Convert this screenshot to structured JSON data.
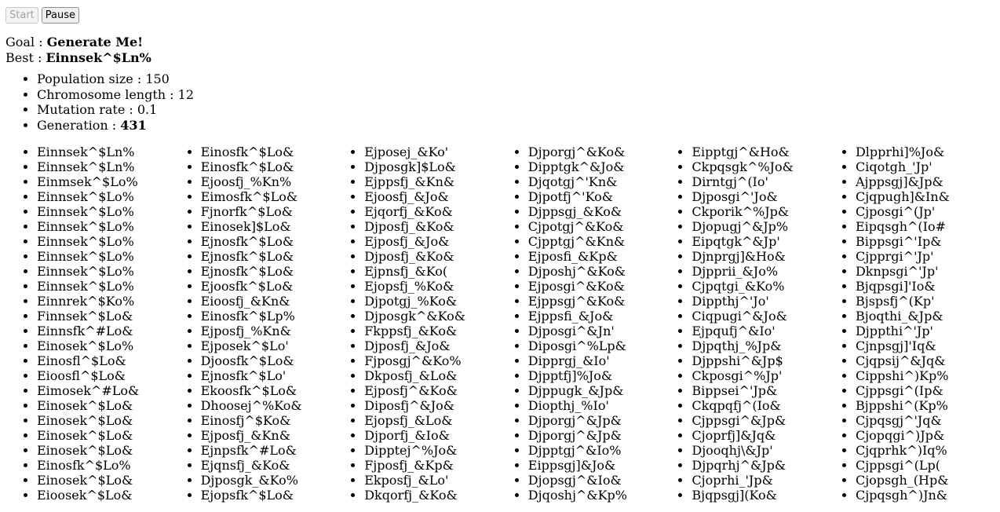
{
  "controls": {
    "start_label": "Start",
    "pause_label": "Pause"
  },
  "goal": {
    "label": "Goal : ",
    "value": "Generate Me!"
  },
  "best": {
    "label": "Best : ",
    "value": "Einnsek^$Ln%"
  },
  "params": {
    "population": {
      "label": "Population size : ",
      "value": "150"
    },
    "chromosome": {
      "label": "Chromosome length : ",
      "value": "12"
    },
    "mutation": {
      "label": "Mutation rate : ",
      "value": "0.1"
    },
    "generation": {
      "label": "Generation : ",
      "value": "431"
    }
  },
  "population": [
    [
      "Einnsek^$Ln%",
      "Einnsek^$Ln%",
      "Einmsek^$Lo%",
      "Einnsek^$Lo%",
      "Einnsek^$Lo%",
      "Einnsek^$Lo%",
      "Einnsek^$Lo%",
      "Einnsek^$Lo%",
      "Einnsek^$Lo%",
      "Einnsek^$Lo%",
      "Einnrek^$Ko%",
      "Finnsek^$Lo&",
      "Einnsfk^#Lo&",
      "Einosek^$Lo%",
      "Einosfl^$Lo&",
      "Eioosfl^$Lo&",
      "Eimosek^#Lo&",
      "Einosek^$Lo&",
      "Einosek^$Lo&",
      "Einosek^$Lo&",
      "Einosek^$Lo&",
      "Einosfk^$Lo%",
      "Einosek^$Lo&",
      "Eioosek^$Lo&"
    ],
    [
      "Einosfk^$Lo&",
      "Einosfk^$Lo&",
      "Ejoosfj_%Kn%",
      "Eimosfk^$Lo&",
      "Fjnorfk^$Lo&",
      "Einosek]$Lo&",
      "Ejnosfk^$Lo&",
      "Ejnosfk^$Lo&",
      "Ejnosfk^$Lo&",
      "Ejoosfk^$Lo&",
      "Eioosfj_&Kn&",
      "Einosfk^$Lp%",
      "Ejposfj_%Kn&",
      "Ejposek^$Lo'",
      "Djoosfk^$Lo&",
      "Ejnosfk^$Lo'",
      "Ekoosfk^$Lo&",
      "Dhoosej^%Ko&",
      "Einosfj^$Ko&",
      "Ejposfj_&Kn&",
      "Ejnpsfk^#Lo&",
      "Ejqnsfj_&Ko&",
      "Djposgk_&Ko%",
      "Ejopsfk^$Lo&"
    ],
    [
      "Ejposej_&Ko'",
      "Djposgk]$Lo&",
      "Ejppsfj_&Kn&",
      "Ejoosfj_&Jo&",
      "Ejqorfj_&Ko&",
      "Djposfj_&Ko&",
      "Ejposfj_&Jo&",
      "Djposfj_&Ko&",
      "Ejpnsfj_&Ko(",
      "Ejopsfj_%Ko&",
      "Djpotgj_%Ko&",
      "Djposgk^&Ko&",
      "Fkppsfj_&Ko&",
      "Djposfj_&Jo&",
      "Fjposgj^&Ko%",
      "Dkposfj_&Lo&",
      "Ejposfj^&Ko&",
      "Diposfj^&Jo&",
      "Ejopsfj_&Lo&",
      "Djporfj_&Io&",
      "Dipptej^%Jo&",
      "Fjposfj_&Kp&",
      "Ekposfj_&Lo'",
      "Dkqorfj_&Ko&"
    ],
    [
      "Djporgj^&Ko&",
      "Dipptgk^&Jo&",
      "Djqotgj^'Kn&",
      "Djpotfj^'Ko&",
      "Djppsgj_&Ko&",
      "Cjpotgj^&Ko&",
      "Cjpptgj^&Kn&",
      "Ejposfi_&Kp&",
      "Djposhj^&Ko&",
      "Ejposgi^&Ko&",
      "Ejppsgj^&Ko&",
      "Ejppsfi_&Jo&",
      "Djposgi^&Jn'",
      "Diposgi^%Lp&",
      "Dipprgj_&Io'",
      "Djpptfj]%Jo&",
      "Djppugk_&Jp&",
      "Diopthj_%Io'",
      "Djporgj^&Jp&",
      "Djporgj^&Jp&",
      "Djpptgj^&Io%",
      "Eippsgj]&Jo&",
      "Djopsgj^&Io&",
      "Djqoshj^&Kp%"
    ],
    [
      "Eipptgj^&Ho&",
      "Ckpqsgk^%Jo&",
      "Dirntgj^(Io'",
      "Djposgi^'Jo&",
      "Ckporik^%Jp&",
      "Djopugj^&Jp%",
      "Eipqtgk^&Jp'",
      "Djnprgj]&Ho&",
      "Djpprii_&Jo%",
      "Cjpqtgi_&Ko%",
      "Dippthj^'Jo'",
      "Ciqpugi^&Jo&",
      "Ejpqufj^&Io'",
      "Djpqthj_%Jp&",
      "Djppshi^&Jp$",
      "Ckposgi^%Jp'",
      "Bippsei^'Jp&",
      "Ckqpqfj^(Io&",
      "Cjppsgi^&Jp&",
      "Cjoprfj]&Jq&",
      "Djooqhj\\&Jp'",
      "Djpqrhj^&Jp&",
      "Cjoprhi_'Jp&",
      "Bjqpsgj](Ko&"
    ],
    [
      "Dlpprhi]%Jo&",
      "Ciqotgh_'Jp'",
      "Ajppsgj]&Jp&",
      "Cjqpugh]&In&",
      "Cjposgi^(Jp'",
      "Eipqsgh^(Io#",
      "Bippsgi^'Ip&",
      "Cjpprgi^'Jp'",
      "Dknpsgi^'Jp'",
      "Bjqpsgi]'Io&",
      "Bjspsfj^(Kp'",
      "Bjoqthi_&Jp&",
      "Djppthi^'Jp'",
      "Cjnpsgj]'Iq&",
      "Cjqpsij^&Jq&",
      "Cippshi^)Kp%",
      "Cjppsgi^(Ip&",
      "Bjppshi^(Kp%",
      "Cjpqsgj^'Jq&",
      "Cjopqgi^)Jp&",
      "Cjqprhk^)Iq%",
      "Cjppsgi^(Lp(",
      "Cjopsgh_(Hp&",
      "Cjpqsgh^)Jn&"
    ]
  ]
}
